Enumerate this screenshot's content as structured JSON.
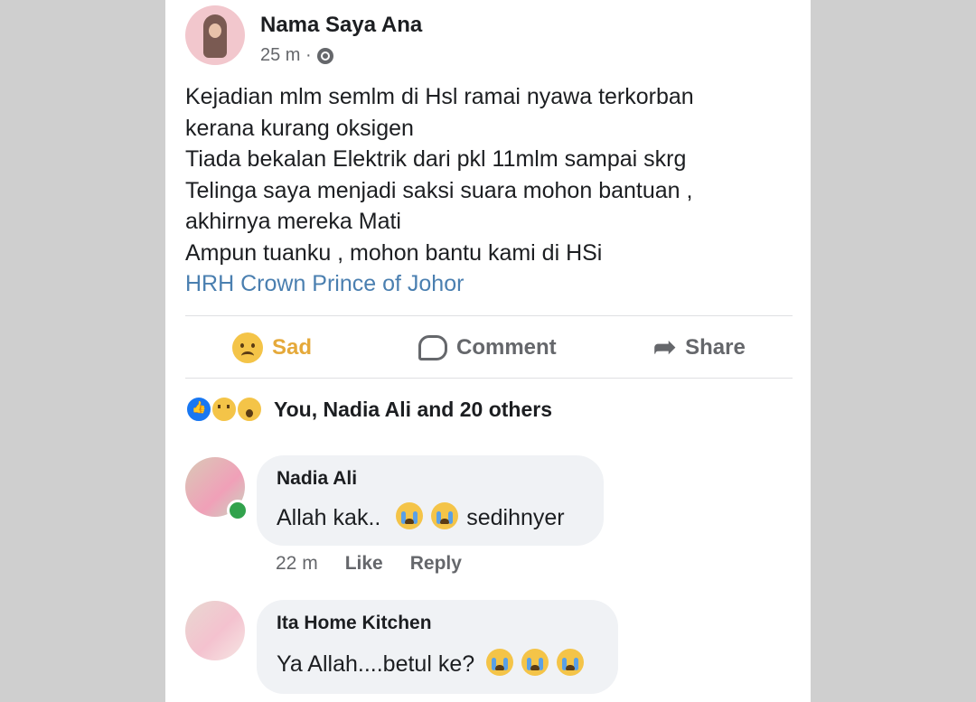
{
  "post": {
    "author": "Nama Saya Ana",
    "time": "25 m ·",
    "lines": [
      "Kejadian mlm semlm di Hsl ramai nyawa terkorban",
      "kerana kurang oksigen",
      "Tiada bekalan Elektrik dari pkl 11mlm sampai skrg",
      "Telinga saya menjadi saksi suara mohon bantuan ,",
      "akhirnya mereka Mati",
      "Ampun tuanku , mohon bantu kami di HSi"
    ],
    "mention": "HRH Crown Prince of Johor"
  },
  "actions": {
    "sad": "Sad",
    "comment": "Comment",
    "share": "Share"
  },
  "reactions": {
    "summary": "You, Nadia Ali and 20 others"
  },
  "comments": [
    {
      "name": "Nadia Ali",
      "text_before": "Allah kak..",
      "text_after": "sedihnyer",
      "time": "22 m",
      "like": "Like",
      "reply": "Reply"
    },
    {
      "name": "Ita Home Kitchen",
      "text_before": "Ya Allah....betul ke?"
    }
  ],
  "colors": {
    "background": "#cfcfcf",
    "mention": "#4a7fb0",
    "sad_reaction": "#e5a93a",
    "secondary_text": "#65676b",
    "bubble": "#f0f2f5"
  }
}
